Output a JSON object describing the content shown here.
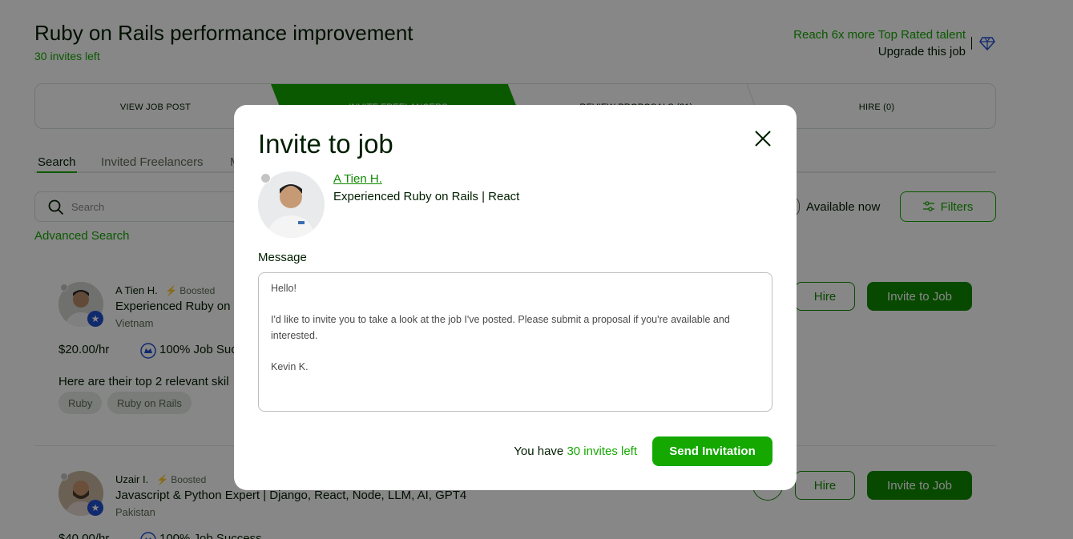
{
  "header": {
    "job_title": "Ruby on Rails performance improvement",
    "invites_left": "30 invites left",
    "reach_text": "Reach 6x more Top Rated talent",
    "upgrade_text": "Upgrade this job",
    "diamond_icon": "diamond-icon"
  },
  "steps": [
    {
      "label": "VIEW JOB POST"
    },
    {
      "label": "INVITE FREELANCERS"
    },
    {
      "label": "REVIEW PROPOSALS (21)"
    },
    {
      "label": "HIRE (0)"
    }
  ],
  "tabs": [
    {
      "label": "Search"
    },
    {
      "label": "Invited Freelancers"
    },
    {
      "label": "M"
    }
  ],
  "search": {
    "placeholder": "Search",
    "advanced_label": "Advanced Search",
    "available_label": "Available now",
    "filters_label": "Filters"
  },
  "freelancers": [
    {
      "name": "A Tien H.",
      "boosted": "Boosted",
      "headline": "Experienced Ruby on",
      "country": "Vietnam",
      "rate": "$20.00/hr",
      "jss": "100% Job Suc",
      "skills_title": "Here are their top 2 relevant skil",
      "skills": [
        "Ruby",
        "Ruby on Rails"
      ],
      "hire_label": "Hire",
      "invite_label": "Invite to Job"
    },
    {
      "name": "Uzair I.",
      "boosted": "Boosted",
      "headline": "Javascript & Python Expert | Django, React, Node, LLM, AI, GPT4",
      "country": "Pakistan",
      "rate": "$40.00/hr",
      "jss": "100% Job Success",
      "hire_label": "Hire",
      "invite_label": "Invite to Job"
    }
  ],
  "modal": {
    "title": "Invite to job",
    "freelancer_name": "A Tien H.",
    "freelancer_headline": "Experienced Ruby on Rails | React",
    "message_label": "Message",
    "message_value": "Hello!\n\nI'd like to invite you to take a look at the job I've posted. Please submit a proposal if you're available and interested.\n\nKevin K.",
    "you_have": "You have",
    "invites_left": "30 invites left",
    "send_label": "Send Invitation"
  },
  "colors": {
    "brand_green": "#14a800",
    "dark_green": "#108a00",
    "text": "#001e00",
    "overlay": "rgba(0,0,0,0.47)"
  }
}
